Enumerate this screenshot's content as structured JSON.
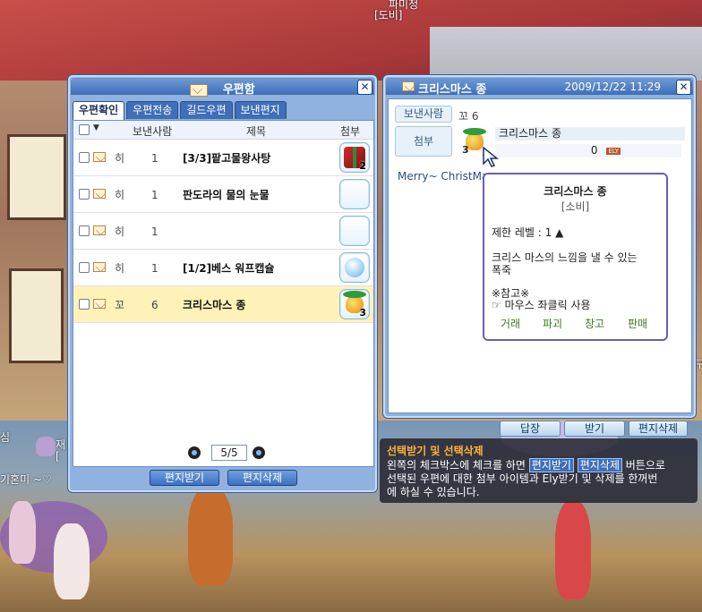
{
  "background": {
    "top_name": "파미정",
    "top_guild": "[도비]",
    "left_chat_1": "기혼미 ~♡",
    "left_name": "재",
    "left_bracket": "[",
    "left_fragment": "심",
    "right_fragment": "구"
  },
  "mailbox": {
    "title": "우편함",
    "close": "✕",
    "tabs": [
      "우편확인",
      "우편전송",
      "길드우편",
      "보낸편지"
    ],
    "headers": {
      "sender": "보낸사람",
      "subject": "제목",
      "attach": "첨부"
    },
    "rows": [
      {
        "sender": "히",
        "sender_tail": "1",
        "subject": "[3/3]팥고물왕사탕",
        "item": "gift",
        "qty": "2",
        "selected": false
      },
      {
        "sender": "히",
        "sender_tail": "1",
        "subject": "판도라의 물의 눈물",
        "item": "empty",
        "qty": "",
        "selected": false
      },
      {
        "sender": "히",
        "sender_tail": "1",
        "subject": "",
        "item": "empty",
        "qty": "",
        "selected": false
      },
      {
        "sender": "히",
        "sender_tail": "1",
        "subject": "[1/2]베스 워프캡슐",
        "item": "orb",
        "qty": "",
        "selected": false
      },
      {
        "sender": "꼬",
        "sender_tail": "6",
        "subject": "크리스마스 종",
        "item": "bell",
        "qty": "3",
        "selected": true
      }
    ],
    "page": "5/5",
    "receive_button": "편지받기",
    "delete_button": "편지삭제"
  },
  "readwin": {
    "title": "크리스마스 종",
    "date": "2009/12/22 11:29",
    "close": "✕",
    "sender_label": "보낸사람",
    "sender_value": "꼬 6",
    "attach_label": "첨부",
    "item_qty": "3",
    "item_name": "크리스마스 종",
    "ely_value": "0",
    "ely_unit": "ELY",
    "message": "Merry~ ChristMa",
    "reply_button": "답장",
    "receive_button": "받기",
    "delete_button": "편지삭제"
  },
  "tooltip": {
    "name": "크리스마스 종",
    "grade": "[소비]",
    "level": "제한 레벨 : 1 ▲",
    "desc1": "크리스 마스의 느낌을 낼 수 있는",
    "desc2": "폭죽",
    "note_title": "※참고※",
    "note_body": "☞ 마우스 좌클릭 사용",
    "actions": [
      "거래",
      "파괴",
      "창고",
      "판매"
    ]
  },
  "help": {
    "title": "선택받기 및 선택삭제",
    "l1_a": "왼쪽의 체크박스에 체크를 하면 ",
    "l1_hl1": "편지받기",
    "l1_hl2": "편지삭제",
    "l1_b": " 버튼으로",
    "l2": "선택된 우편에 대한 첨부 아이템과 Ely받기 및 삭제를 한꺼번",
    "l3": "에 하실 수 있습니다."
  }
}
